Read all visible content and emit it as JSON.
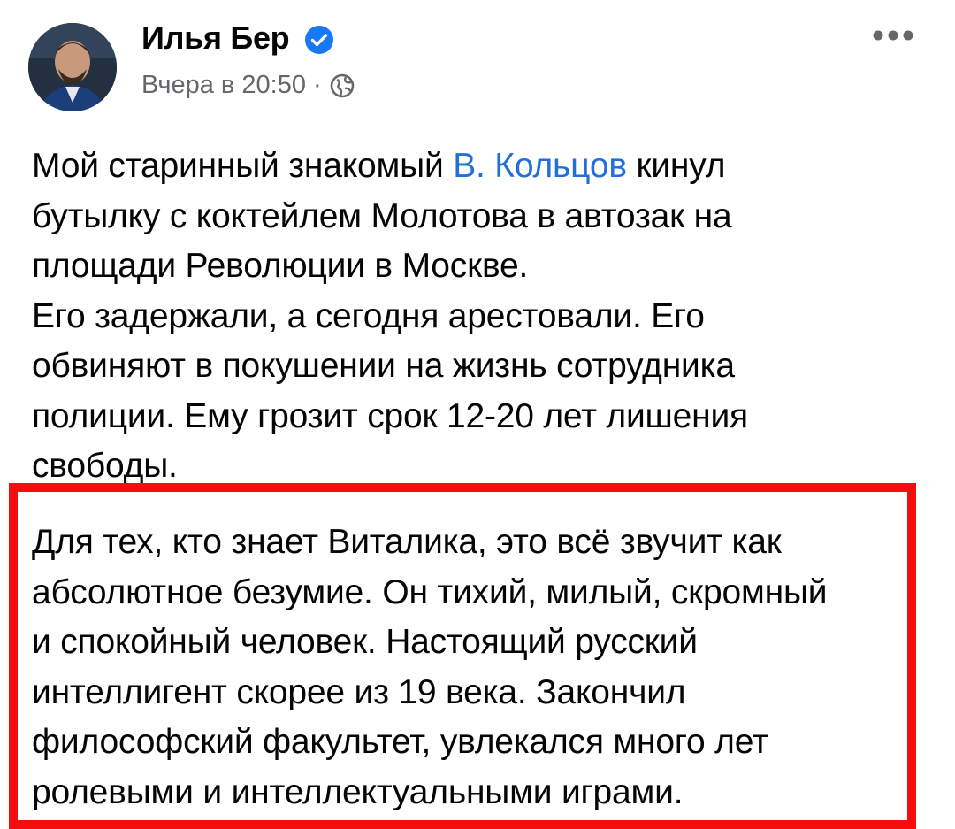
{
  "post": {
    "author": {
      "name": "Илья Бер",
      "verified": true
    },
    "meta": {
      "time": "Вчера в 20:50",
      "separator": "·",
      "privacy_icon": "globe-icon"
    },
    "more_icon": "more-options-icon",
    "text": {
      "line1_before": "Мой старинный знакомый ",
      "mention": "В. Кольцов",
      "line1_after": " кинул",
      "line2": "бутылку с коктейлем Молотова в автозак на",
      "line3": "площади Революции в Москве.",
      "line4": "Его задержали, а сегодня арестовали. Его",
      "line5": "обвиняют в покушении на жизнь сотрудника",
      "line6": "полиции. Ему грозит срок 12-20 лет лишения",
      "line7": "свободы."
    },
    "highlighted": {
      "line1": "Для тех, кто знает Виталика, это всё звучит как",
      "line2": "абсолютное безумие. Он тихий, милый, скромный",
      "line3": "и спокойный человек. Настоящий русский",
      "line4": "интеллигент скорее из 19 века. Закончил",
      "line5": "философский факультет, увлекался много лет",
      "line6": "ролевыми и интеллектуальными играми."
    }
  },
  "colors": {
    "mention": "#216fdb",
    "verified": "#1877f2",
    "highlight_border": "#f50d0d",
    "secondary_text": "#65676b"
  }
}
